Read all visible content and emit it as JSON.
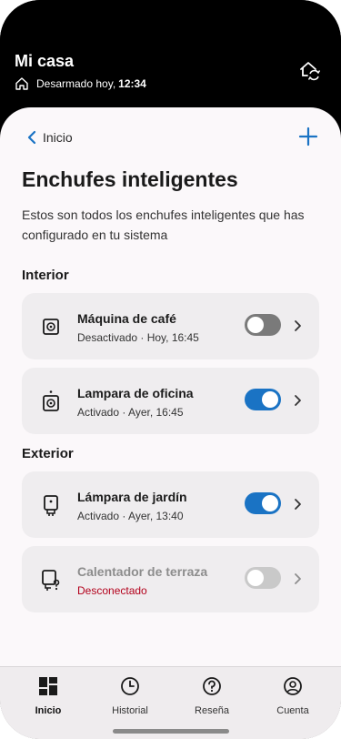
{
  "header": {
    "home_name": "Mi casa",
    "status_text": "Desarmado hoy,",
    "status_time": "12:34"
  },
  "nav": {
    "back_label": "Inicio"
  },
  "page": {
    "title": "Enchufes inteligentes",
    "description": "Estos son todos los enchufes inteligentes que has configurado en tu sistema"
  },
  "sections": {
    "interior": "Interior",
    "exterior": "Exterior"
  },
  "devices": [
    {
      "name": "Máquina de café",
      "status": "Desactivado · Hoy, 16:45",
      "icon": "smart-plug-icon",
      "state": "off"
    },
    {
      "name": "Lampara de oficina",
      "status": "Activado · Ayer, 16:45",
      "icon": "smart-plug-active-icon",
      "state": "on"
    },
    {
      "name": "Lámpara de jardín",
      "status": "Activado · Ayer, 13:40",
      "icon": "outdoor-plug-icon",
      "state": "on"
    },
    {
      "name": "Calentador de terraza",
      "status": "Desconectado",
      "icon": "outdoor-plug-unknown-icon",
      "state": "disconnected"
    }
  ],
  "tabs": [
    {
      "label": "Inicio",
      "icon": "grid-home-icon",
      "active": true
    },
    {
      "label": "Historial",
      "icon": "clock-icon",
      "active": false
    },
    {
      "label": "Reseña",
      "icon": "help-circle-icon",
      "active": false
    },
    {
      "label": "Cuenta",
      "icon": "account-icon",
      "active": false
    }
  ],
  "colors": {
    "accent": "#1a73c4",
    "toggle_off": "#7a7a7a",
    "toggle_disabled": "#c9c9c9",
    "error": "#b3001b",
    "card_bg": "#efedef",
    "sheet_bg": "#fbf8fa"
  }
}
